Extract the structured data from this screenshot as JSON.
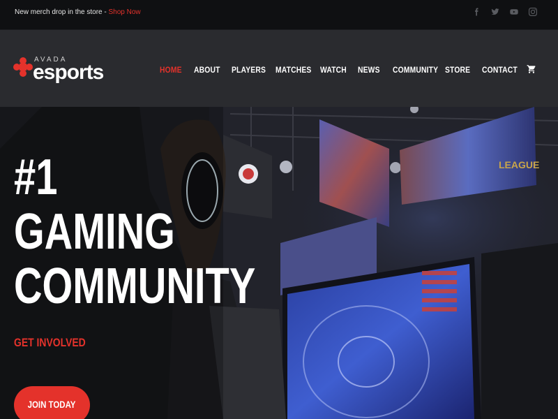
{
  "topbar": {
    "promo_text": "New merch drop in the store - ",
    "promo_link": "Shop Now",
    "social_icons": [
      "facebook-icon",
      "twitter-icon",
      "youtube-icon",
      "instagram-icon"
    ]
  },
  "header": {
    "logo": {
      "small_text": "AVADA",
      "big_text": "esports"
    },
    "nav": [
      "HOME",
      "ABOUT",
      "PLAYERS",
      "MATCHES",
      "WATCH",
      "NEWS",
      "COMMUNITY",
      "STORE",
      "CONTACT"
    ],
    "active_nav": "HOME",
    "cart_icon": "cart-icon"
  },
  "hero": {
    "title_lines": [
      "#1",
      "GAMING",
      "COMMUNITY"
    ],
    "subtitle": "GET INVOLVED",
    "cta": "JOIN TODAY"
  },
  "colors": {
    "accent": "#e4322b",
    "topbar_bg": "#0f1012",
    "header_bg": "#2a2b2f"
  }
}
